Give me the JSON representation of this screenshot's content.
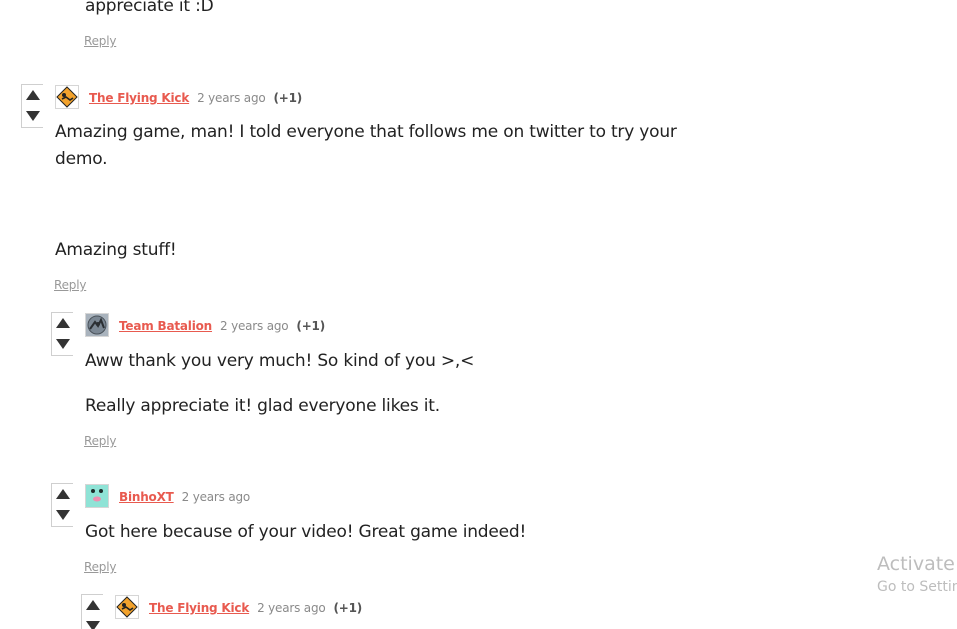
{
  "comments": [
    {
      "paragraphs": [
        "appreciate it :D"
      ],
      "reply_label": "Reply"
    },
    {
      "author": "The Flying Kick",
      "time": "2 years ago",
      "score": "(+1)",
      "avatar": "flying-kick-avatar",
      "paragraphs": [
        "Amazing game, man! I told everyone that follows me on twitter to try your",
        "demo.",
        "Amazing stuff!"
      ],
      "reply_label": "Reply"
    },
    {
      "author": "Team Batalion",
      "time": "2 years ago",
      "score": "(+1)",
      "avatar": "team-batalion-avatar",
      "paragraphs": [
        "Aww thank you very much! So kind of you >,<",
        "Really appreciate it! glad everyone likes it."
      ],
      "reply_label": "Reply"
    },
    {
      "author": "BinhoXT",
      "time": "2 years ago",
      "avatar": "binhoxt-avatar",
      "paragraphs": [
        "Got here because of your video! Great game indeed!"
      ],
      "reply_label": "Reply"
    },
    {
      "author": "The Flying Kick",
      "time": "2 years ago",
      "score": "(+1)",
      "avatar": "flying-kick-avatar"
    }
  ],
  "overlay": {
    "activate_title": "Activate W",
    "activate_sub": "Go to Settin"
  },
  "colors": {
    "author": "#e85a4f",
    "muted": "#999999",
    "text": "#222222"
  },
  "icons": [
    "upvote-arrow-icon",
    "downvote-arrow-icon"
  ]
}
